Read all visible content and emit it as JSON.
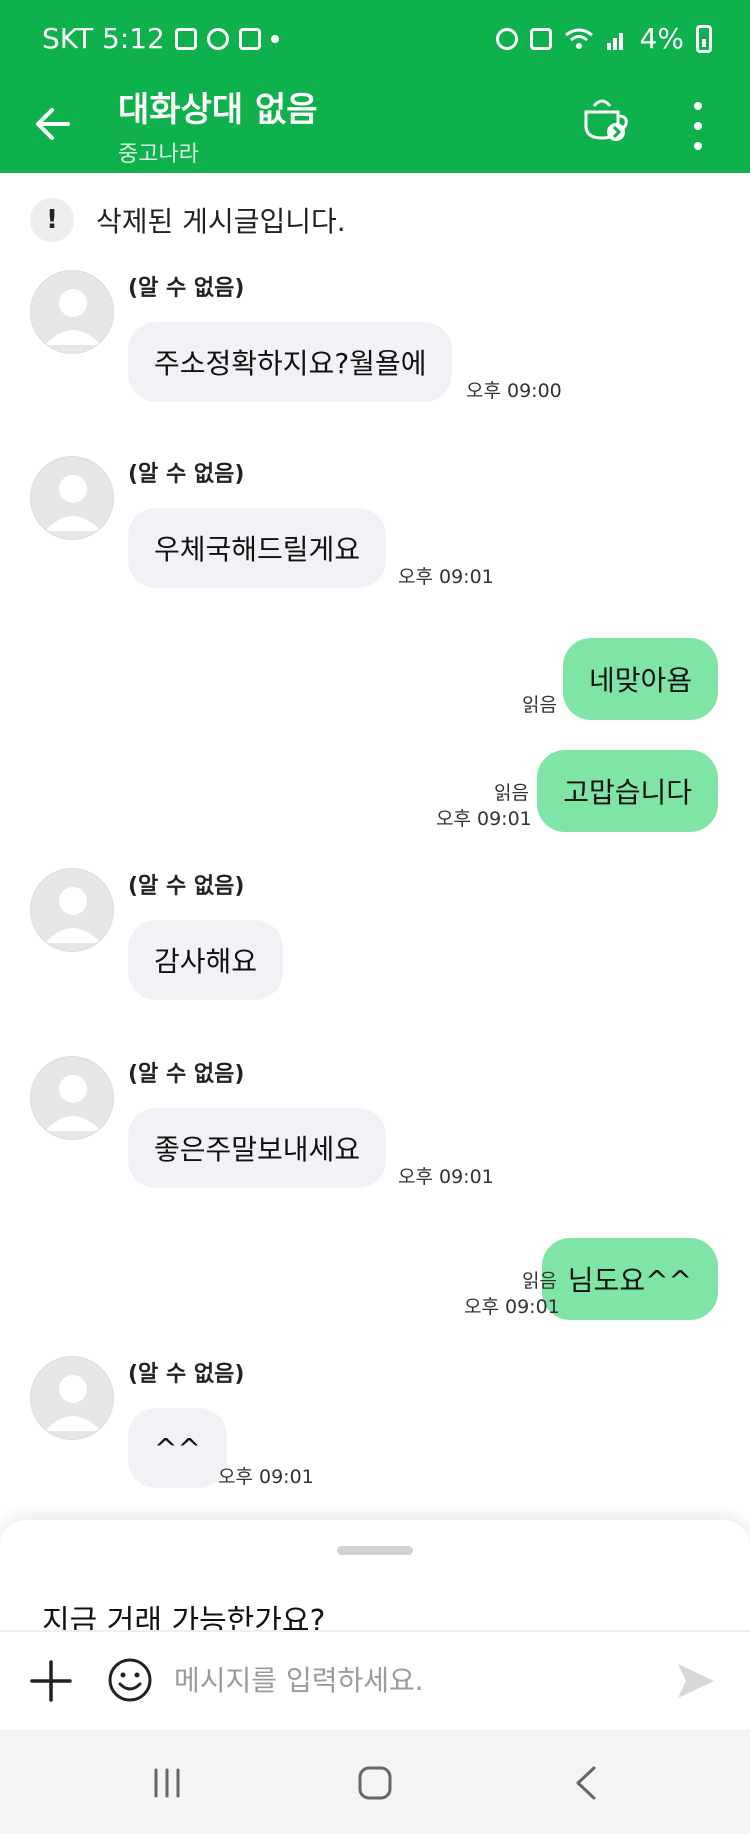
{
  "status_bar": {
    "carrier_time": "SKT 5:12",
    "battery": "4%"
  },
  "header": {
    "title": "대화상대 없음",
    "subtitle": "중고나라"
  },
  "notice": {
    "text": "삭제된 게시글입니다."
  },
  "messages": [
    {
      "sender": "(알 수 없음)",
      "text": "주소정확하지요?월욜에",
      "time": "오후 09:00"
    },
    {
      "sender": "(알 수 없음)",
      "text": "우체국해드릴게요",
      "time": "오후 09:01"
    },
    {
      "text": "네맞아욤",
      "read": "읽음"
    },
    {
      "text": "고맙습니다",
      "read": "읽음",
      "time": "오후 09:01"
    },
    {
      "sender": "(알 수 없음)",
      "text": "감사해요"
    },
    {
      "sender": "(알 수 없음)",
      "text": "좋은주말보내세요",
      "time": "오후 09:01"
    },
    {
      "text": "님도요^^",
      "read": "읽음",
      "time": "오후 09:01"
    },
    {
      "sender": "(알 수 없음)",
      "text": "^^",
      "time": "오후 09:01"
    }
  ],
  "sheet": {
    "suggestion": "지금 거래 가능한가요?"
  },
  "input": {
    "placeholder": "메시지를 입력하세요."
  },
  "colors": {
    "brand": "#0fb14c",
    "outgoing_bubble": "#7ee5a6",
    "incoming_bubble": "#f1f2f5"
  }
}
